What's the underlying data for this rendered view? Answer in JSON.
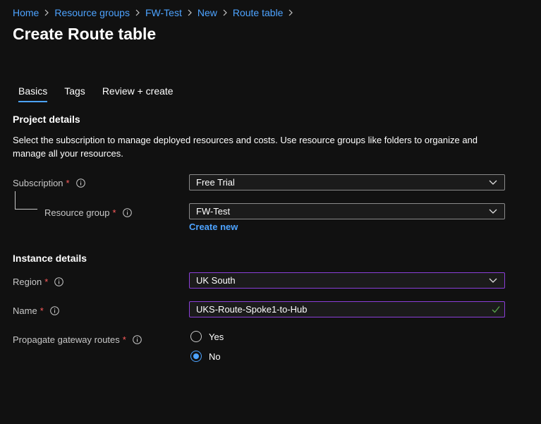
{
  "breadcrumb": [
    "Home",
    "Resource groups",
    "FW-Test",
    "New",
    "Route table"
  ],
  "page_title": "Create Route table",
  "tabs": [
    "Basics",
    "Tags",
    "Review + create"
  ],
  "active_tab": "Basics",
  "project_details": {
    "title": "Project details",
    "description": "Select the subscription to manage deployed resources and costs. Use resource groups like folders to organize and manage all your resources.",
    "subscription_label": "Subscription",
    "subscription_value": "Free Trial",
    "resource_group_label": "Resource group",
    "resource_group_value": "FW-Test",
    "create_new_label": "Create new"
  },
  "instance_details": {
    "title": "Instance details",
    "region_label": "Region",
    "region_value": "UK South",
    "name_label": "Name",
    "name_value": "UKS-Route-Spoke1-to-Hub",
    "propagate_label": "Propagate gateway routes",
    "propagate_options": [
      "Yes",
      "No"
    ],
    "propagate_selected": "No"
  },
  "required_marker": "*",
  "colors": {
    "background": "#111111",
    "link": "#4da3ff",
    "required": "#ff5c5c",
    "focus_border": "#8b3fd9",
    "valid_check": "#57a64a"
  }
}
